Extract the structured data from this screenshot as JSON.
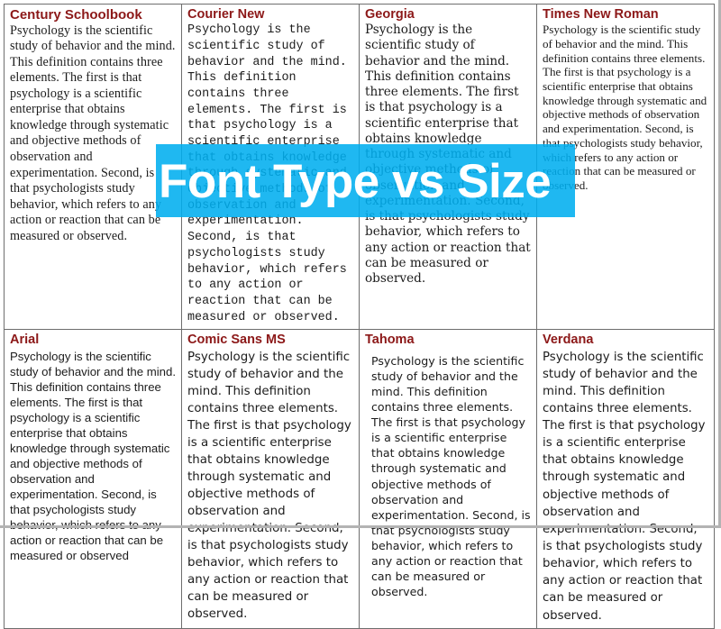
{
  "overlay": {
    "banner_text": "Font Type vs Size",
    "banner_color": "#00AEEF",
    "banner_text_color": "#FFFFFF"
  },
  "theme": {
    "heading_color": "#8C1818",
    "body_color": "#1C1C1C",
    "border_color": "#6E6E6E",
    "background": "#FFFFFF"
  },
  "table": {
    "rows": 2,
    "columns": 4,
    "cells": [
      {
        "heading": "Century Schoolbook",
        "body": "Psychology is the scientific study of behavior and the mind. This definition contains three elements. The first is that psychology is a scientific enterprise that obtains knowledge through systematic and objective methods of observation and experimentation. Second, is that psychologists study behavior, which refers to any action or reaction that can be measured or observed."
      },
      {
        "heading": "Courier New",
        "body": "Psychology is the scientific study of behavior and the mind. This definition contains three elements. The first is that psychology is a scientific enterprise that obtains knowledge through systematic and objective methods of observation and experimentation. Second, is that psychologists study behavior, which refers to any action or reaction that can be measured or observed."
      },
      {
        "heading": "Georgia",
        "body": "Psychology is the scientific study of behavior and the mind. This definition contains three elements. The first is that psychology is a scientific enterprise that obtains knowledge through systematic and objective methods of observation and experimentation. Second, is that psychologists study behavior, which refers to any action or reaction that can be measured or observed."
      },
      {
        "heading": "Times New Roman",
        "body": "Psychology is the scientific study of behavior and the mind. This definition contains three elements. The first is that psychology is a scientific enterprise that obtains knowledge through systematic and objective methods of observation and experimentation. Second, is that psychologists study behavior, which refers to any action or reaction that can be measured or observed."
      },
      {
        "heading": "Arial",
        "body": "Psychology is the scientific study of behavior and the mind. This definition contains three elements. The first is that psychology is a scientific enterprise that obtains knowledge through systematic and objective methods of observation and experimentation. Second, is that psychologists study behavior, which refers to any action or reaction that can be measured or observed"
      },
      {
        "heading": "Comic Sans MS",
        "body": "Psychology is the scientific study of behavior and the mind. This definition contains three elements. The first is that psychology is a scientific enterprise that obtains knowledge through systematic and objective methods of observation and experimentation. Second, is that psychologists study behavior, which refers to any action or reaction that can be measured or observed."
      },
      {
        "heading": "Tahoma",
        "body": "Psychology is the scientific study of behavior and the mind. This definition contains three elements. The first is that psychology is a scientific enterprise that obtains knowledge through systematic and objective methods of observation and experimentation. Second, is that psychologists study behavior, which refers to any action or reaction that can be measured or observed."
      },
      {
        "heading": "Verdana",
        "body": "Psychology is the scientific study of behavior and the mind. This definition contains three elements. The first is that psychology is a scientific enterprise that obtains knowledge through systematic and objective methods of observation and experimentation. Second, is that psychologists study behavior, which refers to any action or reaction that can be measured or observed."
      }
    ]
  }
}
